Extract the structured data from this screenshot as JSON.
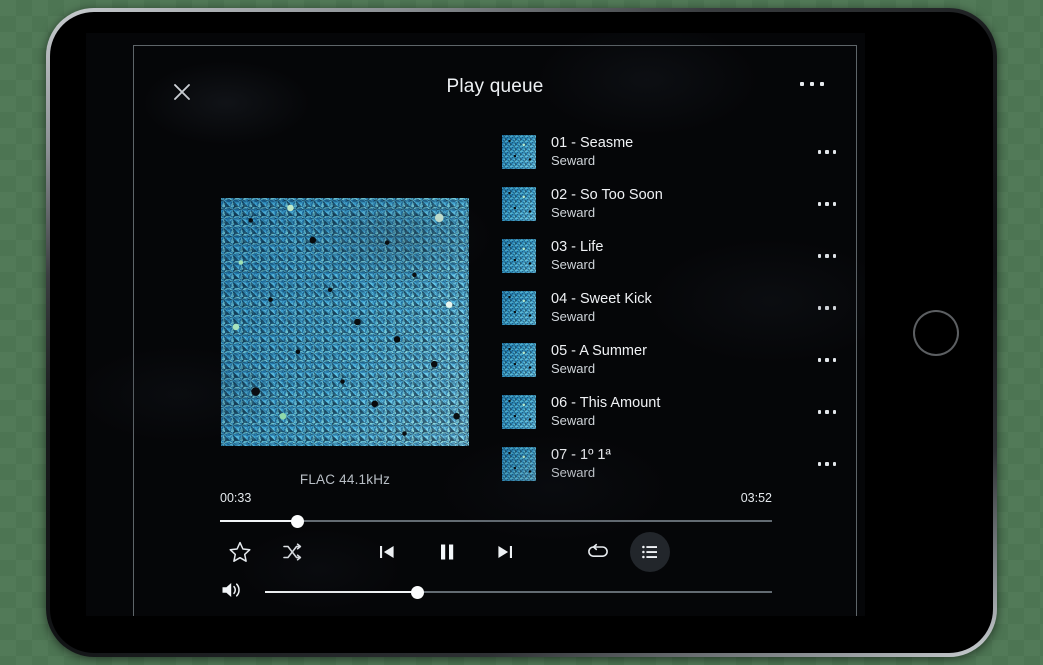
{
  "app": {
    "title": "Play queue"
  },
  "header": {
    "close_icon": "close-icon",
    "more_icon": "more-horizontal-icon"
  },
  "now_playing": {
    "format": "FLAC 44.1kHz",
    "album_art": "album-art-blue-texture",
    "elapsed": "00:33",
    "duration": "03:52",
    "progress_percent": 14,
    "volume_percent": 30
  },
  "queue": {
    "tracks": [
      {
        "title": "01 - Seasme",
        "artist": "Seward"
      },
      {
        "title": "02 - So Too Soon",
        "artist": "Seward"
      },
      {
        "title": "03 - Life",
        "artist": "Seward"
      },
      {
        "title": "04 - Sweet Kick",
        "artist": "Seward"
      },
      {
        "title": "05 - A Summer",
        "artist": "Seward"
      },
      {
        "title": "06 - This Amount",
        "artist": "Seward"
      },
      {
        "title": "07 - 1º 1ª",
        "artist": "Seward"
      }
    ]
  },
  "controls": {
    "favorite": "star-icon",
    "shuffle": "shuffle-icon",
    "previous": "previous-track-icon",
    "play_pause": "pause-icon",
    "next": "next-track-icon",
    "repeat": "repeat-icon",
    "queue": "queue-list-icon",
    "volume": "volume-icon",
    "queue_active": true
  },
  "colors": {
    "accent": "#f2f5f7",
    "screen_background": "#050608",
    "panel_border": "#5e6569",
    "text_primary": "#f0f2f5",
    "text_secondary": "#cfd4d9"
  }
}
